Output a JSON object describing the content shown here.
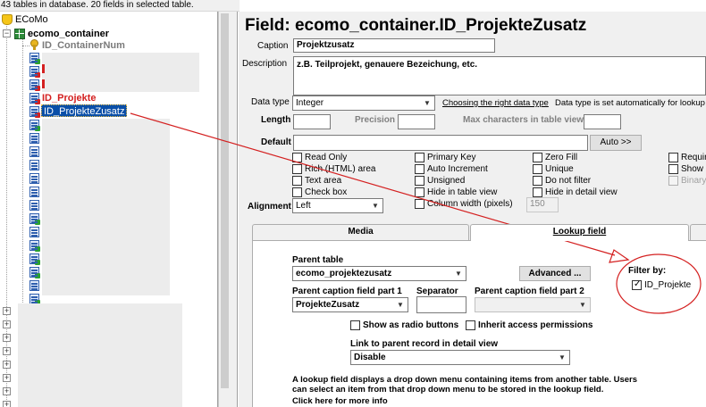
{
  "status_bar": "43 tables in database. 20 fields in selected table.",
  "tree": {
    "root": "ECoMo",
    "table": "ecomo_container",
    "fields": [
      {
        "label": "ID_ContainerNum",
        "style": "gray"
      },
      {
        "label": "ID_Projekte",
        "style": "red"
      },
      {
        "label": "ID_ProjekteZusatz",
        "style": "selected"
      }
    ],
    "expander": "+"
  },
  "field_panel": {
    "title": "Field: ecomo_container.ID_ProjekteZusatz",
    "caption_label": "Caption",
    "caption_value": "Projektzusatz",
    "description_label": "Description",
    "description_value": "z.B. Teilprojekt, genauere Bezeichung, etc.",
    "datatype_label": "Data type",
    "datatype_value": "Integer",
    "datatype_link": "Choosing the right data type",
    "datatype_hint": "Data type is set automatically for lookup fields",
    "length_label": "Length",
    "precision_label": "Precision",
    "maxchars_label": "Max characters in table view",
    "default_label": "Default",
    "auto_button": "Auto >>",
    "checkboxes_col1": [
      "Read Only",
      "Rich (HTML) area",
      "Text area",
      "Check box"
    ],
    "checkboxes_col2": [
      "Primary Key",
      "Auto Increment",
      "Unsigned",
      "Hide in table view",
      "Column width (pixels)"
    ],
    "checkboxes_col3": [
      "Zero Fill",
      "Unique",
      "Do not filter",
      "Hide in detail view"
    ],
    "checkboxes_col4": [
      "Required",
      "Show colu",
      "Binary"
    ],
    "column_width_value": "150",
    "alignment_label": "Alignment",
    "alignment_value": "Left"
  },
  "tabs": {
    "media": "Media",
    "lookup": "Lookup field"
  },
  "lookup": {
    "parent_table_label": "Parent table",
    "parent_table_value": "ecomo_projektezusatz",
    "advanced_button": "Advanced ...",
    "caption1_label": "Parent caption field part 1",
    "caption1_value": "ProjekteZusatz",
    "separator_label": "Separator",
    "caption2_label": "Parent caption field part 2",
    "radio_label": "Show as radio buttons",
    "inherit_label": "Inherit access permissions",
    "link_label": "Link to parent record in detail view",
    "link_value": "Disable",
    "info_text_1": "A lookup field displays a drop down menu containing items from another table. Users",
    "info_text_2": "can select an item from that drop down menu to be stored in the lookup field.",
    "info_text_3": "Click here for more info",
    "filter_label": "Filter by:",
    "filter_item": "ID_Projekte"
  },
  "colors": {
    "accent_red": "#d42020",
    "selection": "#0a4fa8"
  }
}
